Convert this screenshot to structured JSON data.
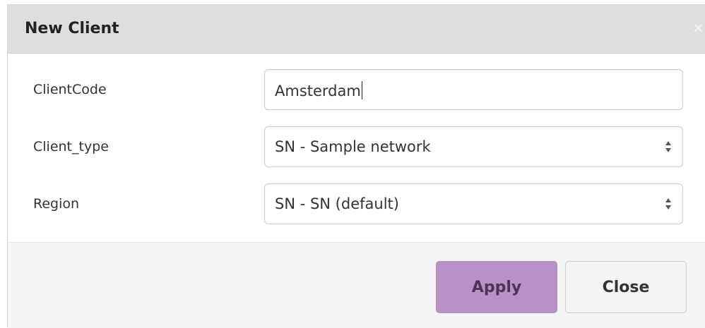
{
  "dialog": {
    "title": "New Client",
    "close_glyph": "×"
  },
  "form": {
    "client_code": {
      "label": "ClientCode",
      "value": "Amsterdam"
    },
    "client_type": {
      "label": "Client_type",
      "selected": "SN - Sample network"
    },
    "region": {
      "label": "Region",
      "selected": "SN - SN (default)"
    }
  },
  "footer": {
    "apply_label": "Apply",
    "close_label": "Close"
  },
  "colors": {
    "header_bg": "#dedede",
    "apply_bg": "#b892c6",
    "footer_bg": "#f5f5f5"
  }
}
